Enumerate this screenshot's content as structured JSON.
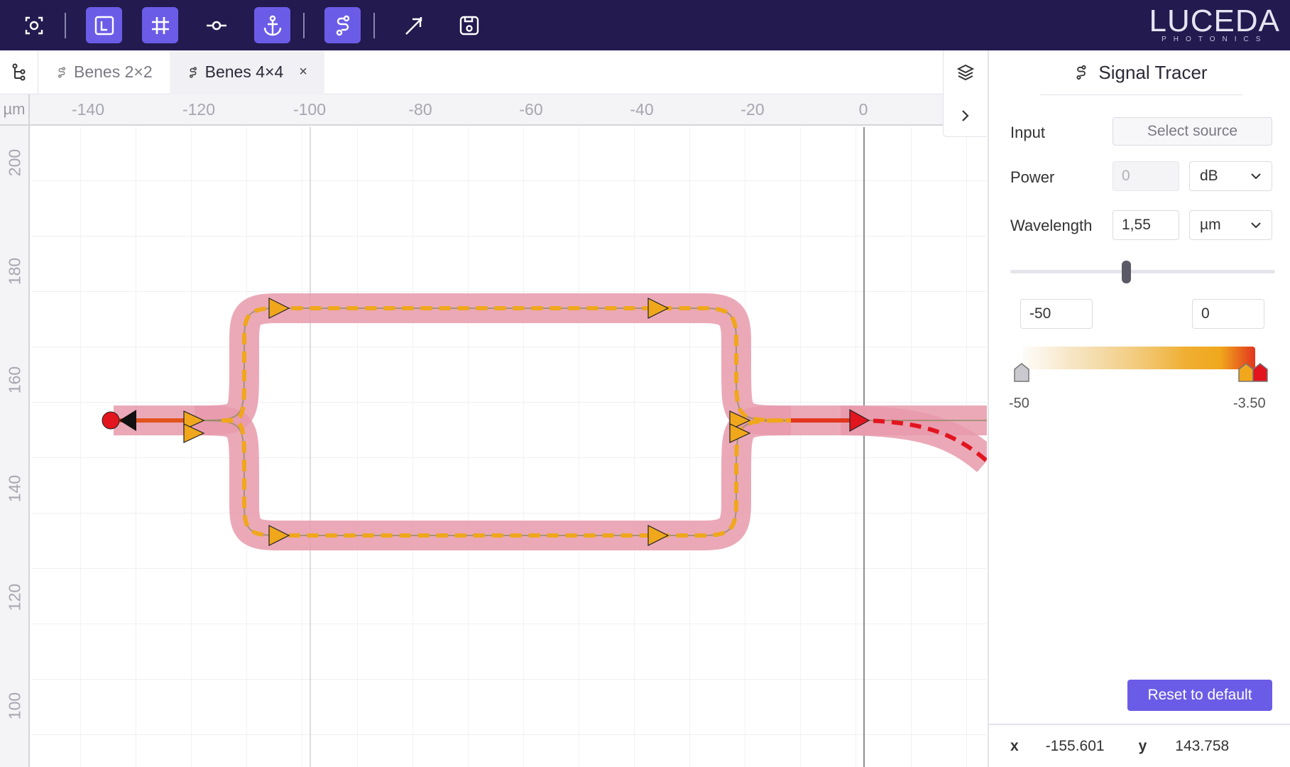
{
  "toolbar": {
    "buttons": [
      {
        "name": "fit-view",
        "icon": "fit-view-icon",
        "active": false
      },
      {
        "name": "layout",
        "icon": "layout-icon",
        "active": true
      },
      {
        "name": "grid",
        "icon": "grid-icon",
        "active": true
      },
      {
        "name": "port",
        "icon": "port-icon",
        "active": false
      },
      {
        "name": "anchor",
        "icon": "anchor-icon",
        "active": true
      },
      {
        "name": "signal",
        "icon": "signal-route-icon",
        "active": true
      },
      {
        "name": "export",
        "icon": "export-icon",
        "active": false
      },
      {
        "name": "save",
        "icon": "save-icon",
        "active": false
      }
    ],
    "brand": "LUCEDA",
    "brand_sub": "PHOTONICS"
  },
  "tabs": [
    {
      "label": "Benes 2×2",
      "active": false
    },
    {
      "label": "Benes 4×4",
      "active": true,
      "close": "×"
    }
  ],
  "canvas": {
    "unit": "µm",
    "x_ticks": [
      "-140",
      "-120",
      "-100",
      "-80",
      "-60",
      "-40",
      "-20",
      "0"
    ],
    "y_ticks": [
      "200",
      "180",
      "160",
      "140",
      "120",
      "100"
    ]
  },
  "signal_tracer": {
    "title": "Signal Tracer",
    "input_label": "Input",
    "input_button": "Select source",
    "power_label": "Power",
    "power_value": "0",
    "power_unit": "dB",
    "wavelength_label": "Wavelength",
    "wavelength_value": "1,55",
    "wavelength_unit": "µm",
    "range_min_value": "-50",
    "range_max_value": "0",
    "gradient_min_label": "-50",
    "gradient_max_label": "-3.50",
    "reset_button": "Reset to default"
  },
  "cursor": {
    "x_label": "x",
    "x_value": "-155.601",
    "y_label": "y",
    "y_value": "143.758"
  },
  "colors": {
    "toolbar_bg": "#231a4f",
    "accent": "#6b5ce7",
    "waveguide": "#e79aac",
    "signal": "#f0a71c",
    "signal_hot": "#e2141e"
  }
}
